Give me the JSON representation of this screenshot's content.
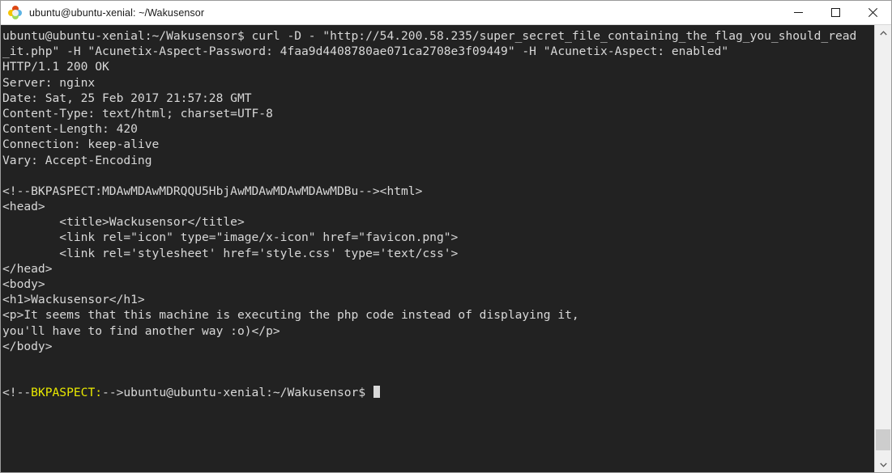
{
  "window": {
    "title": "ubuntu@ubuntu-xenial: ~/Wakusensor",
    "app_icon": "ubuntu-terminal-icon",
    "controls": {
      "minimize": "Minimize",
      "maximize": "Maximize",
      "close": "Close"
    },
    "colors": {
      "terminal_background": "#222222",
      "terminal_foreground": "#d8d8d8",
      "highlight_yellow": "#e8e800",
      "titlebar_background": "#ffffff",
      "scrollbar_track": "#f0f0f0",
      "scrollbar_thumb": "#cdcdcd"
    }
  },
  "terminal": {
    "prompt": "ubuntu@ubuntu-xenial:~/Wakusensor$",
    "lines": [
      {
        "id": "command-line-1",
        "text": "ubuntu@ubuntu-xenial:~/Wakusensor$ curl -D - \"http://54.200.58.235/super_secret_file_containing_the_flag_you_should_read"
      },
      {
        "id": "command-line-2",
        "text": "_it.php\" -H \"Acunetix-Aspect-Password: 4faa9d4408780ae071ca2708e3f09449\" -H \"Acunetix-Aspect: enabled\""
      },
      {
        "id": "http-status",
        "text": "HTTP/1.1 200 OK"
      },
      {
        "id": "header-server",
        "text": "Server: nginx"
      },
      {
        "id": "header-date",
        "text": "Date: Sat, 25 Feb 2017 21:57:28 GMT"
      },
      {
        "id": "header-content-type",
        "text": "Content-Type: text/html; charset=UTF-8"
      },
      {
        "id": "header-content-length",
        "text": "Content-Length: 420"
      },
      {
        "id": "header-connection",
        "text": "Connection: keep-alive"
      },
      {
        "id": "header-vary",
        "text": "Vary: Accept-Encoding"
      },
      {
        "id": "blank-1",
        "text": ""
      },
      {
        "id": "body-comment-html",
        "text": "<!--BKPASPECT:MDAwMDAwMDRQQU5HbjAwMDAwMDAwMDAwMDBu--><html>"
      },
      {
        "id": "body-head-open",
        "text": "<head>"
      },
      {
        "id": "body-title",
        "text": "        <title>Wackusensor</title>"
      },
      {
        "id": "body-link-icon",
        "text": "        <link rel=\"icon\" type=\"image/x-icon\" href=\"favicon.png\">"
      },
      {
        "id": "body-link-stylesheet",
        "text": "        <link rel='stylesheet' href='style.css' type='text/css'>"
      },
      {
        "id": "body-head-close",
        "text": "</head>"
      },
      {
        "id": "body-body-open",
        "text": "<body>"
      },
      {
        "id": "body-h1",
        "text": "<h1>Wackusensor</h1>"
      },
      {
        "id": "body-p-1",
        "text": "<p>It seems that this machine is executing the php code instead of displaying it,"
      },
      {
        "id": "body-p-2",
        "text": "you'll have to find another way :o)</p>"
      },
      {
        "id": "body-body-close",
        "text": "</body>"
      },
      {
        "id": "blank-2",
        "text": ""
      },
      {
        "id": "blank-3",
        "text": ""
      }
    ],
    "final_line": {
      "prefix": "<!--",
      "highlight": "BKPASPECT:",
      "suffix": "-->ubuntu@ubuntu-xenial:~/Wakusensor$ "
    }
  },
  "scrollbar": {
    "up_arrow": "scroll-up",
    "down_arrow": "scroll-down",
    "thumb": "scroll-thumb"
  }
}
